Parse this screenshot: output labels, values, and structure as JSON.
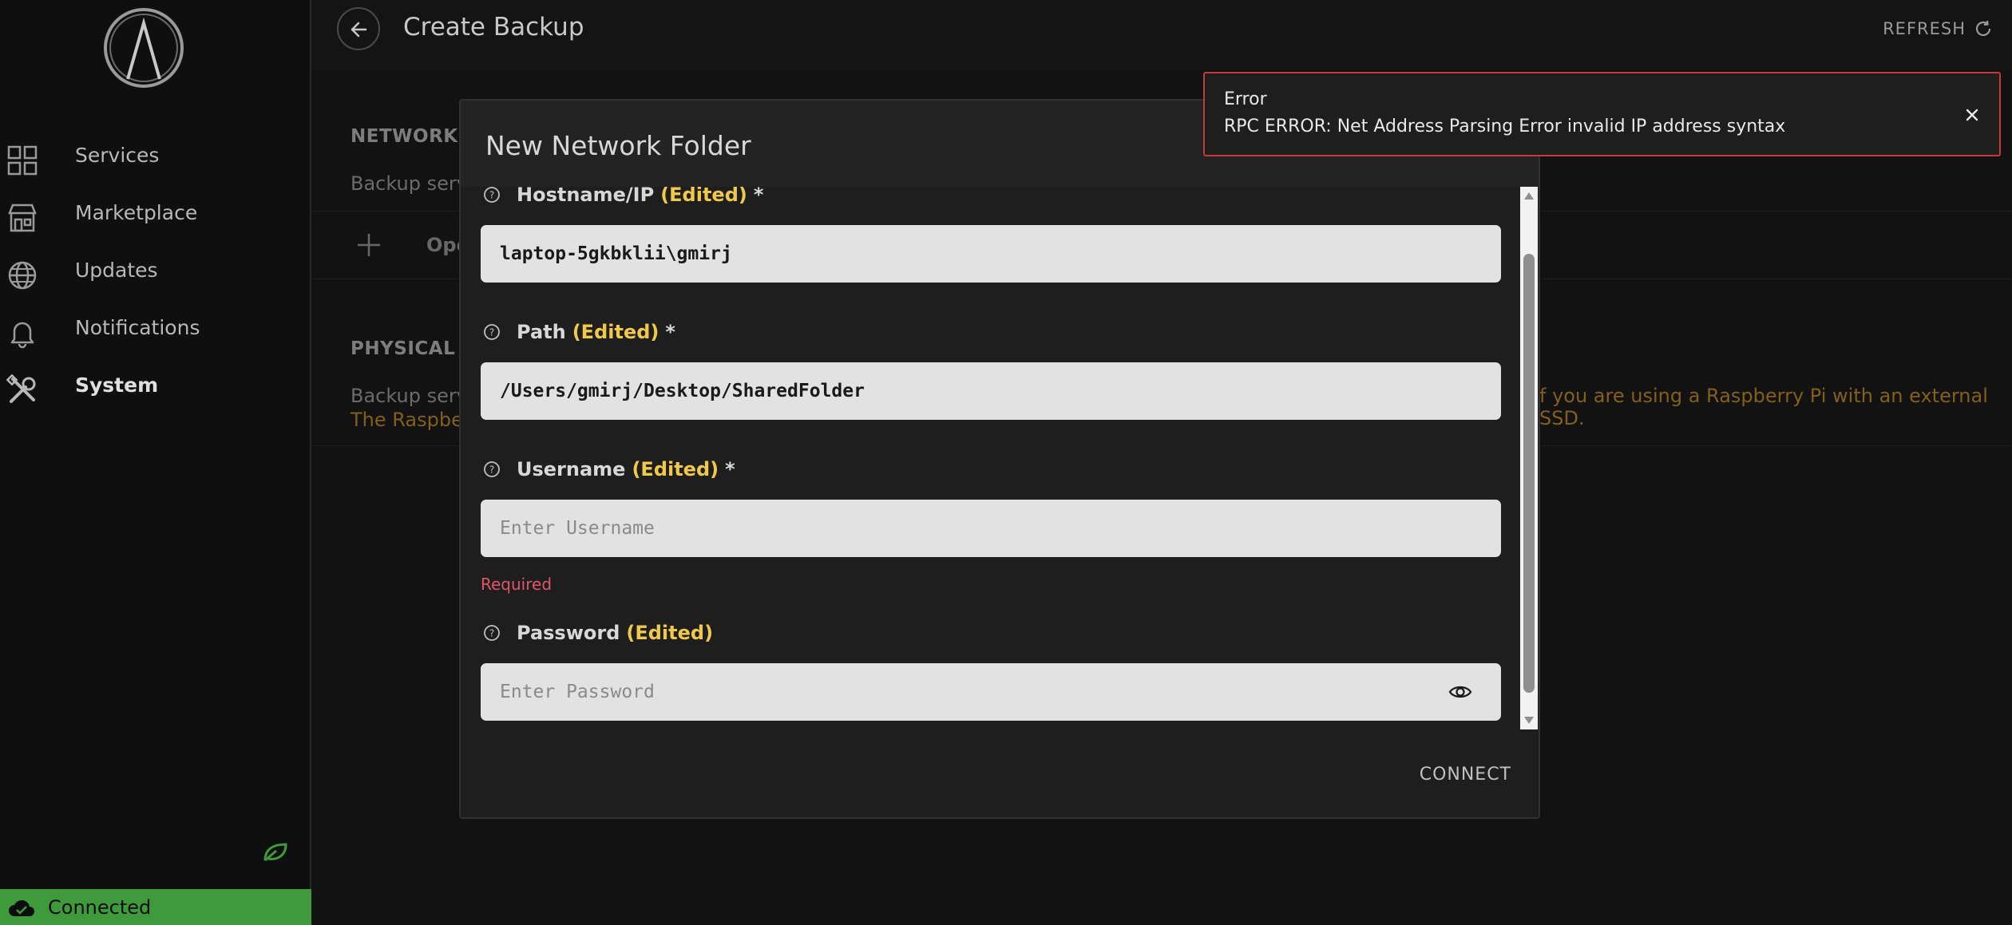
{
  "sidebar": {
    "items": [
      {
        "label": "Services",
        "icon": "grid-icon"
      },
      {
        "label": "Marketplace",
        "icon": "store-icon"
      },
      {
        "label": "Updates",
        "icon": "globe-icon"
      },
      {
        "label": "Notifications",
        "icon": "bell-icon"
      },
      {
        "label": "System",
        "icon": "tools-icon",
        "active": true
      }
    ],
    "status": "Connected"
  },
  "header": {
    "title": "Create Backup",
    "refresh_label": "REFRESH"
  },
  "background": {
    "network_heading": "NETWORK F",
    "network_desc": "Backup serve",
    "open_label": "Ope",
    "physical_heading": "PHYSICAL D",
    "physical_desc": "Backup serve",
    "physical_warning_line1": "f you are using a Raspberry Pi with an external SSD.",
    "physical_warning_line2": "The Raspber"
  },
  "modal": {
    "title": "New Network Folder",
    "edited_tag": "(Edited)",
    "required_mark": "*",
    "fields": {
      "hostname": {
        "label": "Hostname/IP",
        "value": "laptop-5gkbklii\\gmirj"
      },
      "path": {
        "label": "Path",
        "value": "/Users/gmirj/Desktop/SharedFolder"
      },
      "username": {
        "label": "Username",
        "placeholder": "Enter Username",
        "error": "Required"
      },
      "password": {
        "label": "Password",
        "placeholder": "Enter Password"
      }
    },
    "connect_label": "CONNECT"
  },
  "toast": {
    "title": "Error",
    "message": "RPC ERROR: Net Address Parsing Error invalid IP address syntax"
  },
  "colors": {
    "accent_edited": "#f0c84a",
    "error_red": "#c23a3a",
    "connected_green": "#3f9a3c",
    "warning_orange": "#c8922a"
  }
}
